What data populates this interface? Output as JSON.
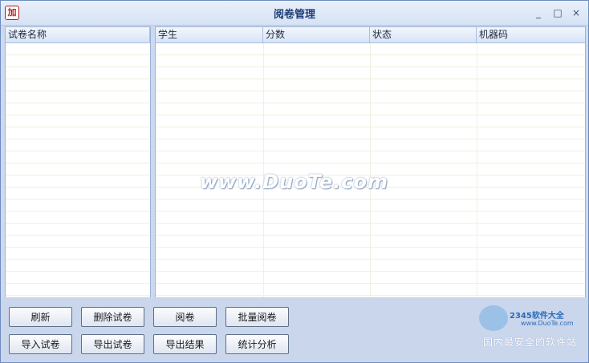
{
  "window": {
    "title": "阅卷管理",
    "icon": "加",
    "controls": [
      "_",
      "□",
      "×"
    ]
  },
  "left_table": {
    "headers": [
      "试卷名称"
    ]
  },
  "right_table": {
    "headers": [
      "学生",
      "分数",
      "状态",
      "机器码"
    ]
  },
  "buttons": {
    "refresh": "刷新",
    "delete_paper": "删除试卷",
    "grade": "阅卷",
    "batch_grade": "批量阅卷",
    "import_paper": "导入试卷",
    "export_paper": "导出试卷",
    "export_result": "导出结果",
    "statistics": "统计分析"
  },
  "watermark": "www.DuoTe.com",
  "logo": {
    "brand": "2345软件大全",
    "url": "www.DuoTe.com",
    "slogan": "国内最安全的软件站"
  }
}
